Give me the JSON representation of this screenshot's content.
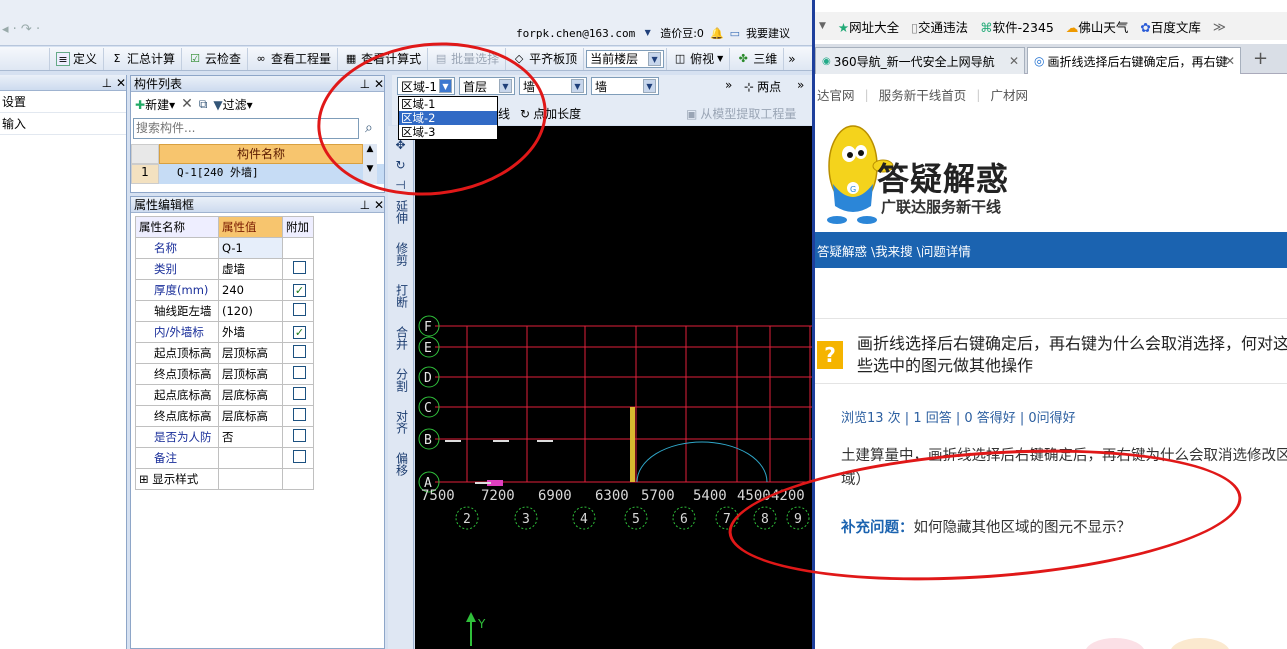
{
  "app": {
    "account": "forpk.chen@163.com",
    "beans": "造价豆:0",
    "suggest": "我要建议",
    "toolbar": [
      "定义",
      "汇总计算",
      "云检查",
      "查看工程量",
      "查看计算式",
      "批量选择",
      "平齐板顶",
      "当前楼层",
      "俯视",
      "三维"
    ],
    "left_panel": {
      "rows": [
        "设置",
        "输入"
      ]
    },
    "comp_list": {
      "title": "构件列表",
      "new_btn": "新建",
      "filter_btn": "过滤",
      "search_placeholder": "搜索构件...",
      "col_header": "构件名称",
      "rows": [
        {
          "idx": "1",
          "name": "Q-1[240 外墙]"
        }
      ]
    },
    "attr_panel": {
      "title": "属性编辑框",
      "headers": [
        "属性名称",
        "属性值",
        "附加"
      ],
      "rows": [
        {
          "name": "名称",
          "value": "Q-1",
          "checked": null
        },
        {
          "name": "类别",
          "value": "虚墙",
          "checked": false
        },
        {
          "name": "厚度(mm)",
          "value": "240",
          "checked": true
        },
        {
          "name": "轴线距左墙",
          "value": "(120)",
          "checked": false
        },
        {
          "name": "内/外墙标",
          "value": "外墙",
          "checked": true
        },
        {
          "name": "起点顶标高",
          "value": "层顶标高",
          "checked": false
        },
        {
          "name": "终点顶标高",
          "value": "层顶标高",
          "checked": false
        },
        {
          "name": "起点底标高",
          "value": "层底标高",
          "checked": false
        },
        {
          "name": "终点底标高",
          "value": "层底标高",
          "checked": false
        },
        {
          "name": "是否为人防",
          "value": "否",
          "checked": false
        },
        {
          "name": "备注",
          "value": "",
          "checked": false
        },
        {
          "name": "显示样式",
          "value": "",
          "checked": null
        }
      ]
    },
    "selects": {
      "region": "区域-1",
      "floor": "首层",
      "type": "墙",
      "sub": "墙"
    },
    "region_options": [
      "区域-1",
      "区域-2",
      "区域-3"
    ],
    "draw_tools": {
      "two_points": "两点",
      "point_len": "点加长度",
      "line": "线",
      "extract": "从模型提取工程量"
    },
    "vtools": [
      "延伸",
      "修剪",
      "打断",
      "合并",
      "分割",
      "对齐",
      "偏移"
    ],
    "grid": {
      "row_labels": [
        "F",
        "E",
        "D",
        "C",
        "B",
        "A"
      ],
      "col_labels": [
        "2",
        "3",
        "4",
        "5",
        "6",
        "7",
        "8",
        "9"
      ],
      "dims": [
        "7500",
        "7200",
        "6900",
        "6300",
        "5700",
        "5400",
        "4500",
        "4200"
      ],
      "axis_y": "Y"
    }
  },
  "browser": {
    "favorites": [
      "网址大全",
      "交通违法",
      "软件-2345",
      "佛山天气",
      "百度文库"
    ],
    "tabs": [
      {
        "title": "360导航_新一代安全上网导航"
      },
      {
        "title": "画折线选择后右键确定后，再右键"
      }
    ],
    "links": [
      "达官网",
      "服务新干线首页",
      "广材网"
    ],
    "brand": "答疑解惑",
    "brand_sub": "广联达服务新干线",
    "breadcrumb": "答疑解惑 \\我来搜 \\问题详情",
    "question_title": "画折线选择后右键确定后，再右键为什么会取消选择，何对这些选中的图元做其他操作",
    "stats": "浏览13 次 | 1 回答 | 0 答得好 | 0问得好",
    "body_text": "土建算量中，画折线选择后右键确定后，再右键为什么会取消选修改区域）",
    "supplement_label": "补充问题：",
    "supplement_text": "如何隐藏其他区域的图元不显示？"
  }
}
